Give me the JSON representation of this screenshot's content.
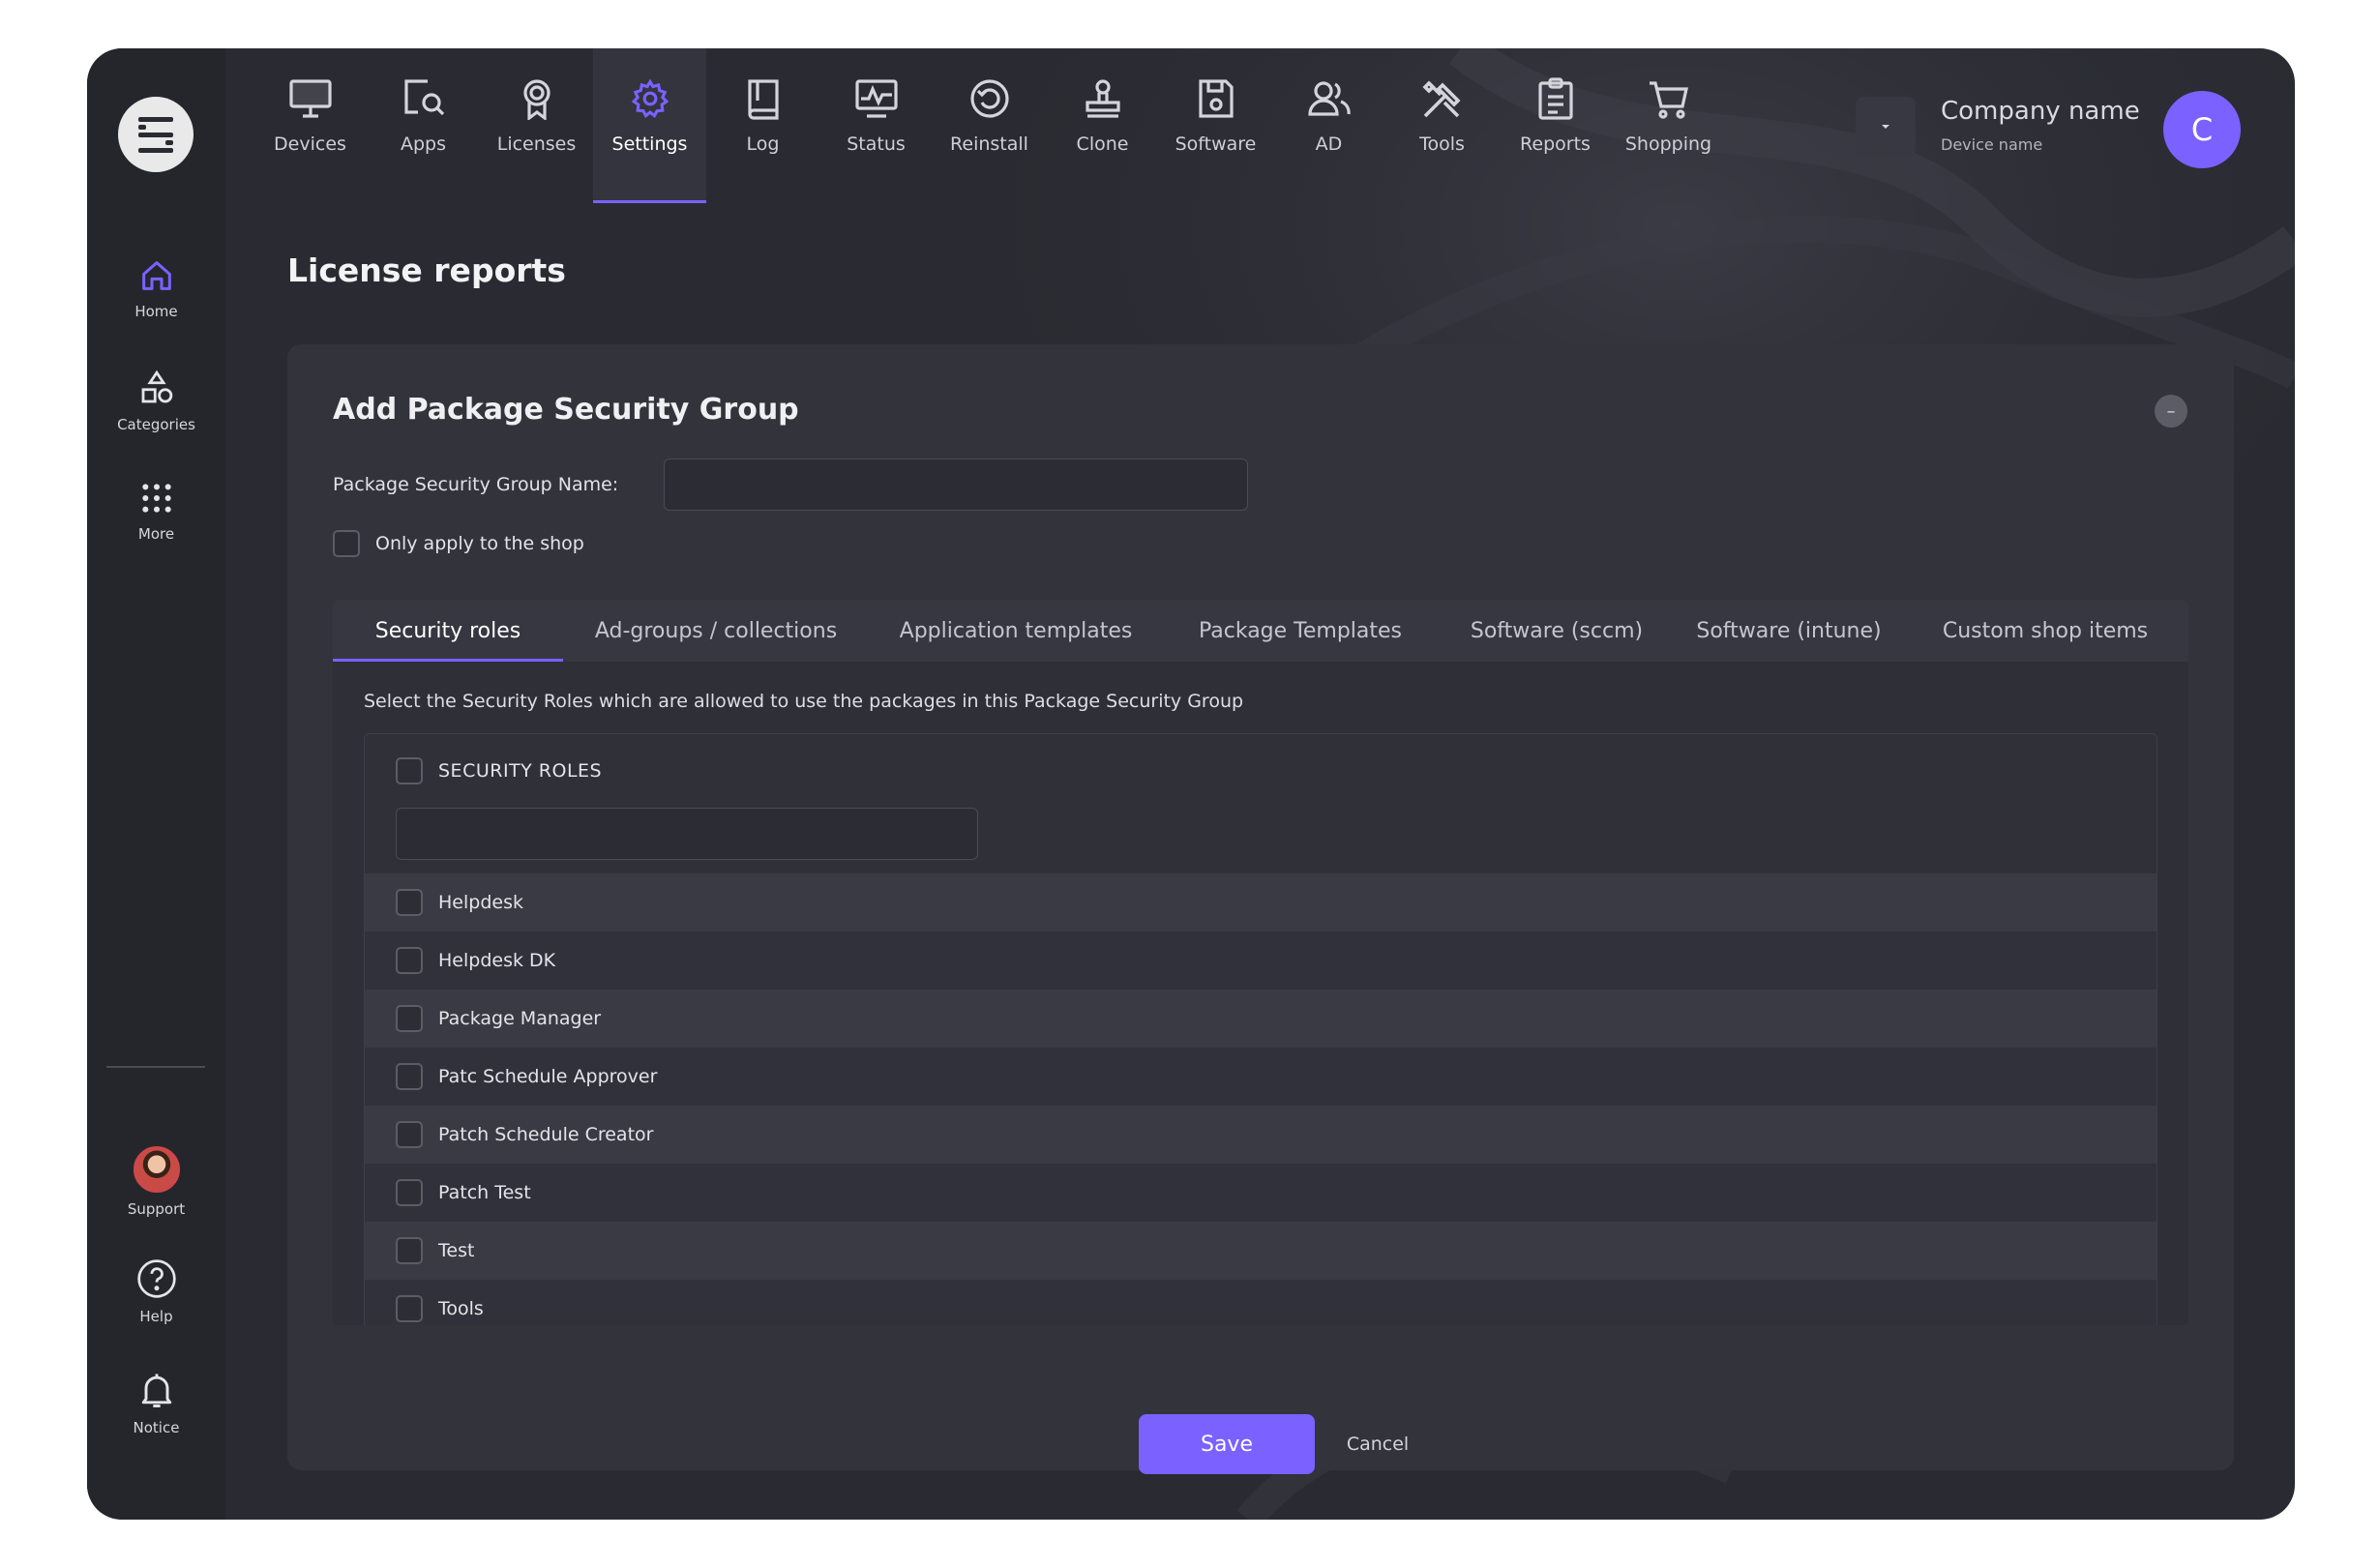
{
  "colors": {
    "accent": "#7b61ff",
    "background": "#2a2b32",
    "sidebar": "#25262c",
    "card": "#32333b"
  },
  "sidebar": {
    "logo_icon": "s-logo-icon",
    "items": [
      {
        "label": "Home",
        "icon": "home-icon"
      },
      {
        "label": "Categories",
        "icon": "shapes-icon"
      },
      {
        "label": "More",
        "icon": "grid-dots-icon"
      }
    ],
    "bottom_items": [
      {
        "label": "Support",
        "icon": "support-avatar"
      },
      {
        "label": "Help",
        "icon": "help-icon"
      },
      {
        "label": "Notice",
        "icon": "bell-icon"
      }
    ]
  },
  "topnav": {
    "items": [
      {
        "label": "Devices",
        "icon": "monitor-icon"
      },
      {
        "label": "Apps",
        "icon": "app-search-icon"
      },
      {
        "label": "Licenses",
        "icon": "badge-icon"
      },
      {
        "label": "Settings",
        "icon": "gear-icon",
        "active": true
      },
      {
        "label": "Log",
        "icon": "book-icon"
      },
      {
        "label": "Status",
        "icon": "chart-monitor-icon"
      },
      {
        "label": "Reinstall",
        "icon": "reinstall-icon"
      },
      {
        "label": "Clone",
        "icon": "stamp-icon"
      },
      {
        "label": "Software",
        "icon": "disk-icon"
      },
      {
        "label": "AD",
        "icon": "users-icon"
      },
      {
        "label": "Tools",
        "icon": "tools-icon"
      },
      {
        "label": "Reports",
        "icon": "clipboard-icon"
      },
      {
        "label": "Shopping",
        "icon": "cart-icon"
      }
    ]
  },
  "company": {
    "name": "Company name",
    "device": "Device name",
    "avatar_letter": "C"
  },
  "page": {
    "title": "License reports"
  },
  "card": {
    "title": "Add Package Security Group",
    "collapse_symbol": "–",
    "name_label": "Package Security Group Name:",
    "name_value": "",
    "shop_only_label": "Only apply to the shop"
  },
  "tabs": [
    {
      "label": "Security roles",
      "active": true
    },
    {
      "label": "Ad-groups / collections"
    },
    {
      "label": "Application templates"
    },
    {
      "label": "Package Templates"
    },
    {
      "label": "Software (sccm)"
    },
    {
      "label": "Software (intune)"
    },
    {
      "label": "Custom shop items"
    }
  ],
  "security_roles": {
    "description": "Select the Security Roles which are allowed to use the packages in this Package Security Group",
    "header": "SECURITY ROLES",
    "filter_value": "",
    "roles": [
      "Helpdesk",
      "Helpdesk DK",
      "Package Manager",
      "Patc Schedule Approver",
      "Patch Schedule Creator",
      "Patch Test",
      "Test",
      "Tools"
    ]
  },
  "actions": {
    "save": "Save",
    "cancel": "Cancel"
  }
}
